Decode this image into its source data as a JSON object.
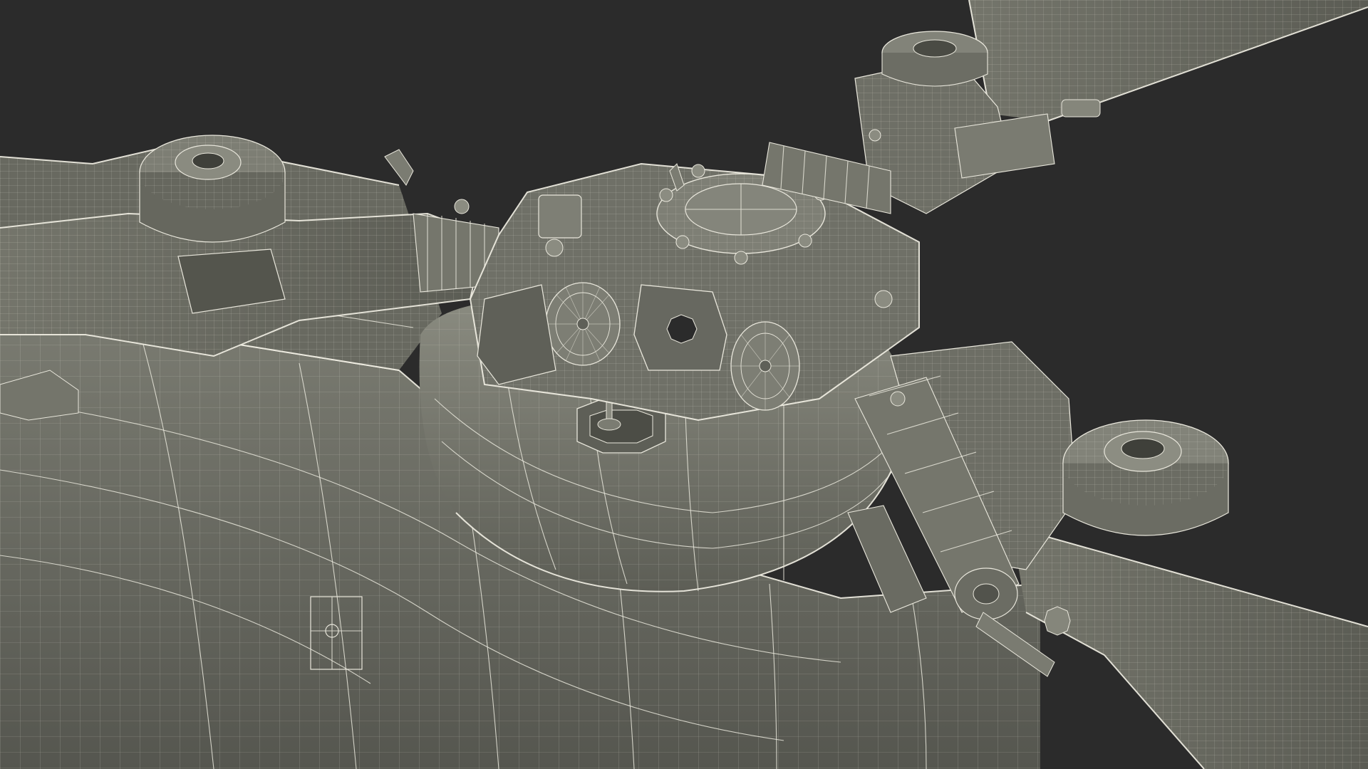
{
  "scene": {
    "subject": "helicopter-main-rotor-hub-wireframe",
    "colors": {
      "background": "#2b2b2b",
      "surface": "#6b6c62",
      "surface_dark": "#4f5049",
      "surface_light": "#8b8c81",
      "wireframe": "#e9e7dc"
    }
  }
}
